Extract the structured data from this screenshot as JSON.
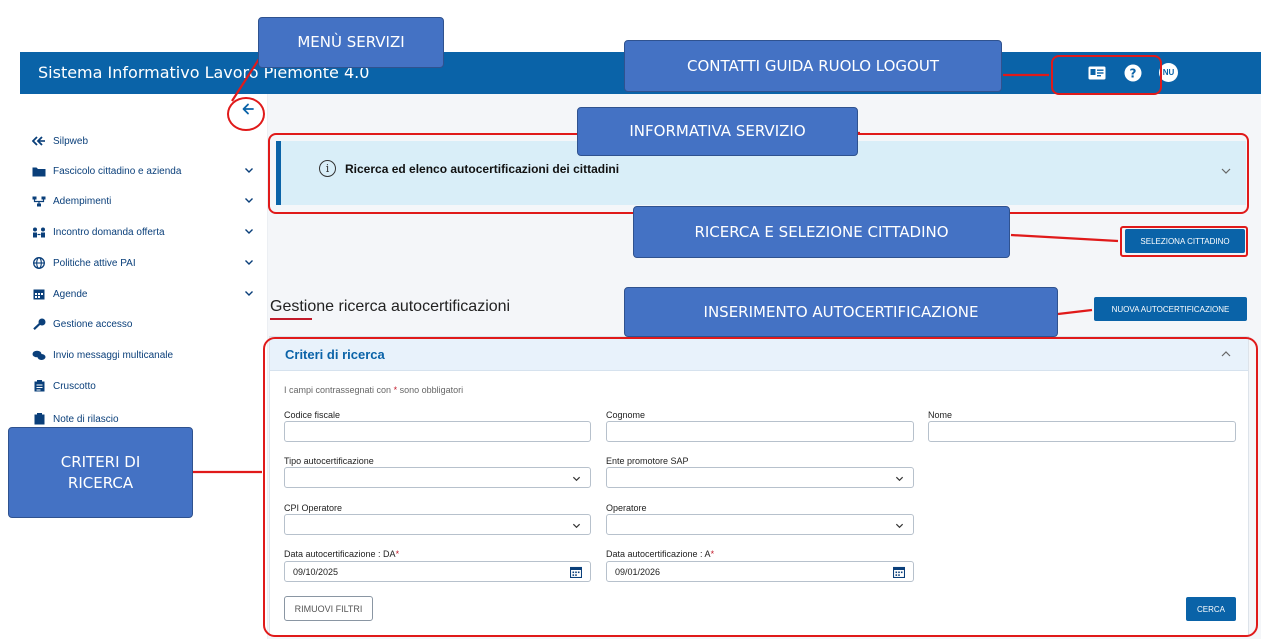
{
  "header": {
    "title": "Sistema Informativo Lavoro Piemonte 4.0",
    "icons": [
      "contact-card-icon",
      "help-icon",
      "user-avatar-icon"
    ],
    "avatar_initials": "NU"
  },
  "sidebar": {
    "items": [
      {
        "label": "Silpweb",
        "icon": "back-arrows-icon",
        "expandable": false
      },
      {
        "label": "Fascicolo cittadino e azienda",
        "icon": "folder-icon",
        "expandable": true
      },
      {
        "label": "Adempimenti",
        "icon": "workflow-icon",
        "expandable": true
      },
      {
        "label": "Incontro domanda offerta",
        "icon": "people-exchange-icon",
        "expandable": true
      },
      {
        "label": "Politiche attive PAI",
        "icon": "globe-icon",
        "expandable": true
      },
      {
        "label": "Agende",
        "icon": "calendar-icon",
        "expandable": true
      },
      {
        "label": "Gestione accesso",
        "icon": "key-icon",
        "expandable": false
      },
      {
        "label": "Invio messaggi multicanale",
        "icon": "chat-icon",
        "expandable": false
      },
      {
        "label": "Cruscotto",
        "icon": "clipboard-icon",
        "expandable": false
      },
      {
        "label": "Note di rilascio",
        "icon": "notes-icon",
        "expandable": false
      }
    ]
  },
  "main": {
    "info_banner_text": "Ricerca ed elenco autocertificazioni dei cittadini",
    "select_citizen_button": "SELEZIONA CITTADINO",
    "section_title": "Gestione ricerca autocertificazioni",
    "new_button": "NUOVA AUTOCERTIFICAZIONE",
    "panel": {
      "title": "Criteri di ricerca",
      "required_note_before": "I campi contrassegnati con ",
      "required_note_star": "*",
      "required_note_after": " sono obbligatori",
      "fields": {
        "codice_fiscale": {
          "label": "Codice fiscale",
          "value": ""
        },
        "cognome": {
          "label": "Cognome",
          "value": ""
        },
        "nome": {
          "label": "Nome",
          "value": ""
        },
        "tipo": {
          "label": "Tipo autocertificazione",
          "value": ""
        },
        "ente": {
          "label": "Ente promotore SAP",
          "value": ""
        },
        "cpi": {
          "label": "CPI Operatore",
          "value": ""
        },
        "operatore": {
          "label": "Operatore",
          "value": ""
        },
        "data_da": {
          "label": "Data autocertificazione : DA",
          "required": "*",
          "value": "09/10/2025"
        },
        "data_a": {
          "label": "Data autocertificazione : A",
          "required": "*",
          "value": "09/01/2026"
        }
      },
      "reset_button": "RIMUOVI FILTRI",
      "search_button": "CERCA"
    }
  },
  "annotations": {
    "menu": "MENÙ SERVIZI",
    "contacts": "CONTATTI GUIDA RUOLO LOGOUT",
    "info": "INFORMATIVA SERVIZIO",
    "select": "RICERCA E SELEZIONE CITTADINO",
    "insert": "INSERIMENTO AUTOCERTIFICAZIONE",
    "criteria_line1": "CRITERI DI",
    "criteria_line2": "RICERCA"
  },
  "colors": {
    "header_blue": "#0a63a8",
    "annotation_blue": "#4472c4",
    "annotation_red": "#e01a1a",
    "banner_bg": "#d9eef8"
  }
}
